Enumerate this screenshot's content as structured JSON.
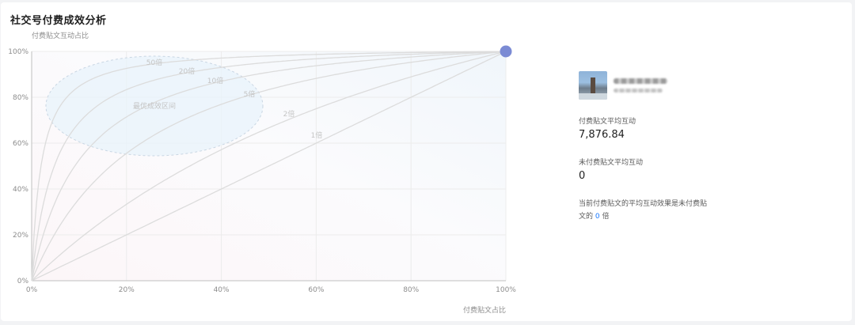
{
  "card": {
    "title": "社交号付费成效分析"
  },
  "chart_data": {
    "type": "line",
    "ylabel": "付费贴文互动占比",
    "xlabel": "付费贴文占比",
    "xlim": [
      0,
      100
    ],
    "ylim": [
      0,
      100
    ],
    "x_ticks": [
      "0%",
      "20%",
      "40%",
      "60%",
      "80%",
      "100%"
    ],
    "y_ticks": [
      "0%",
      "20%",
      "40%",
      "60%",
      "80%",
      "100%"
    ],
    "grid": true,
    "series": [
      {
        "name": "1倍",
        "multiplier": 1
      },
      {
        "name": "2倍",
        "multiplier": 2
      },
      {
        "name": "5倍",
        "multiplier": 5
      },
      {
        "name": "10倍",
        "multiplier": 10
      },
      {
        "name": "20倍",
        "multiplier": 20
      },
      {
        "name": "50倍",
        "multiplier": 50
      }
    ],
    "zone": {
      "label": "最优成效区间"
    },
    "point": {
      "x": 100,
      "y": 100
    },
    "colors": {
      "point": "#7b8bd4",
      "curve": "#dcdcdc",
      "zone_fill": "#e8f3fb",
      "zone_stroke": "#c9d6e3"
    }
  },
  "account": {
    "avatar_icon": "account-avatar"
  },
  "stats": {
    "paid_label": "付费贴文平均互动",
    "paid_value": "7,876.84",
    "unpaid_label": "未付费贴文平均互动",
    "unpaid_value": "0"
  },
  "note": {
    "text_before": "当前付费贴文的平均互动效果是未付费贴文的",
    "multiple": "0",
    "text_after": "倍"
  }
}
